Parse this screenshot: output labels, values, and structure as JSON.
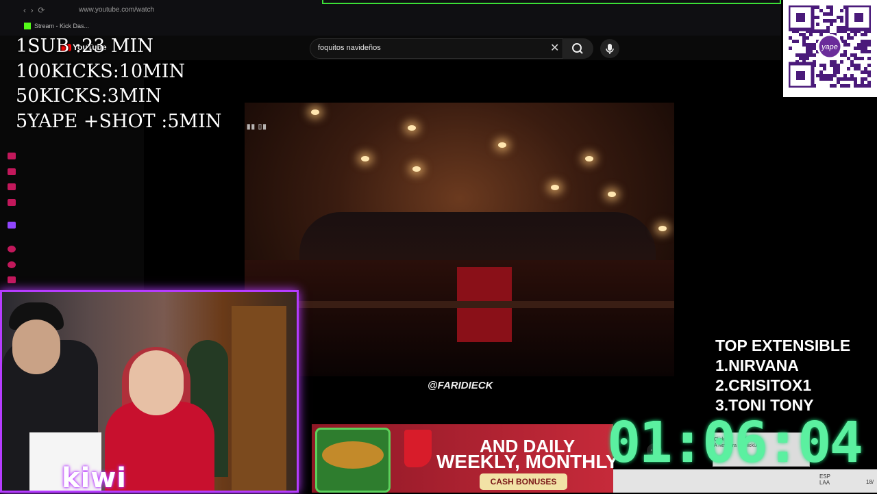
{
  "browser": {
    "url": "www.youtube.com/watch",
    "bookmark_label": "Stream - Kick Das..."
  },
  "youtube": {
    "logo_text": "YouTube",
    "search_value": "foquitos navideños"
  },
  "overlay_rules": [
    "1SUB :23 MIN",
    "100KICKS:10MIN",
    "50KICKS:3MIN",
    "5YAPE +SHOT :5MIN"
  ],
  "video": {
    "watermark": "@FARIDIECK"
  },
  "qr": {
    "brand": "yape"
  },
  "top_list": {
    "title": "TOP EXTENSIBLE",
    "items": [
      "1.NIRVANA",
      "2.CRISITOX1",
      "3.TONI TONY"
    ]
  },
  "timer": "01:06:04",
  "ad": {
    "line1": "AND DAILY",
    "line2": "WEEKLY, MONTHLY",
    "button": "CASH BONUSES"
  },
  "taskbar": {
    "lang_top": "ESP",
    "lang_bottom": "LAA",
    "date_partial": "18/"
  },
  "notification": {
    "line1": "ClickUp",
    "line2": "A New Era of ClickUp"
  },
  "colors": {
    "timer": "#5bf0a0",
    "cam_border": "#b63cff",
    "kick_green": "#53fc18",
    "youtube_red": "#ff0000"
  }
}
